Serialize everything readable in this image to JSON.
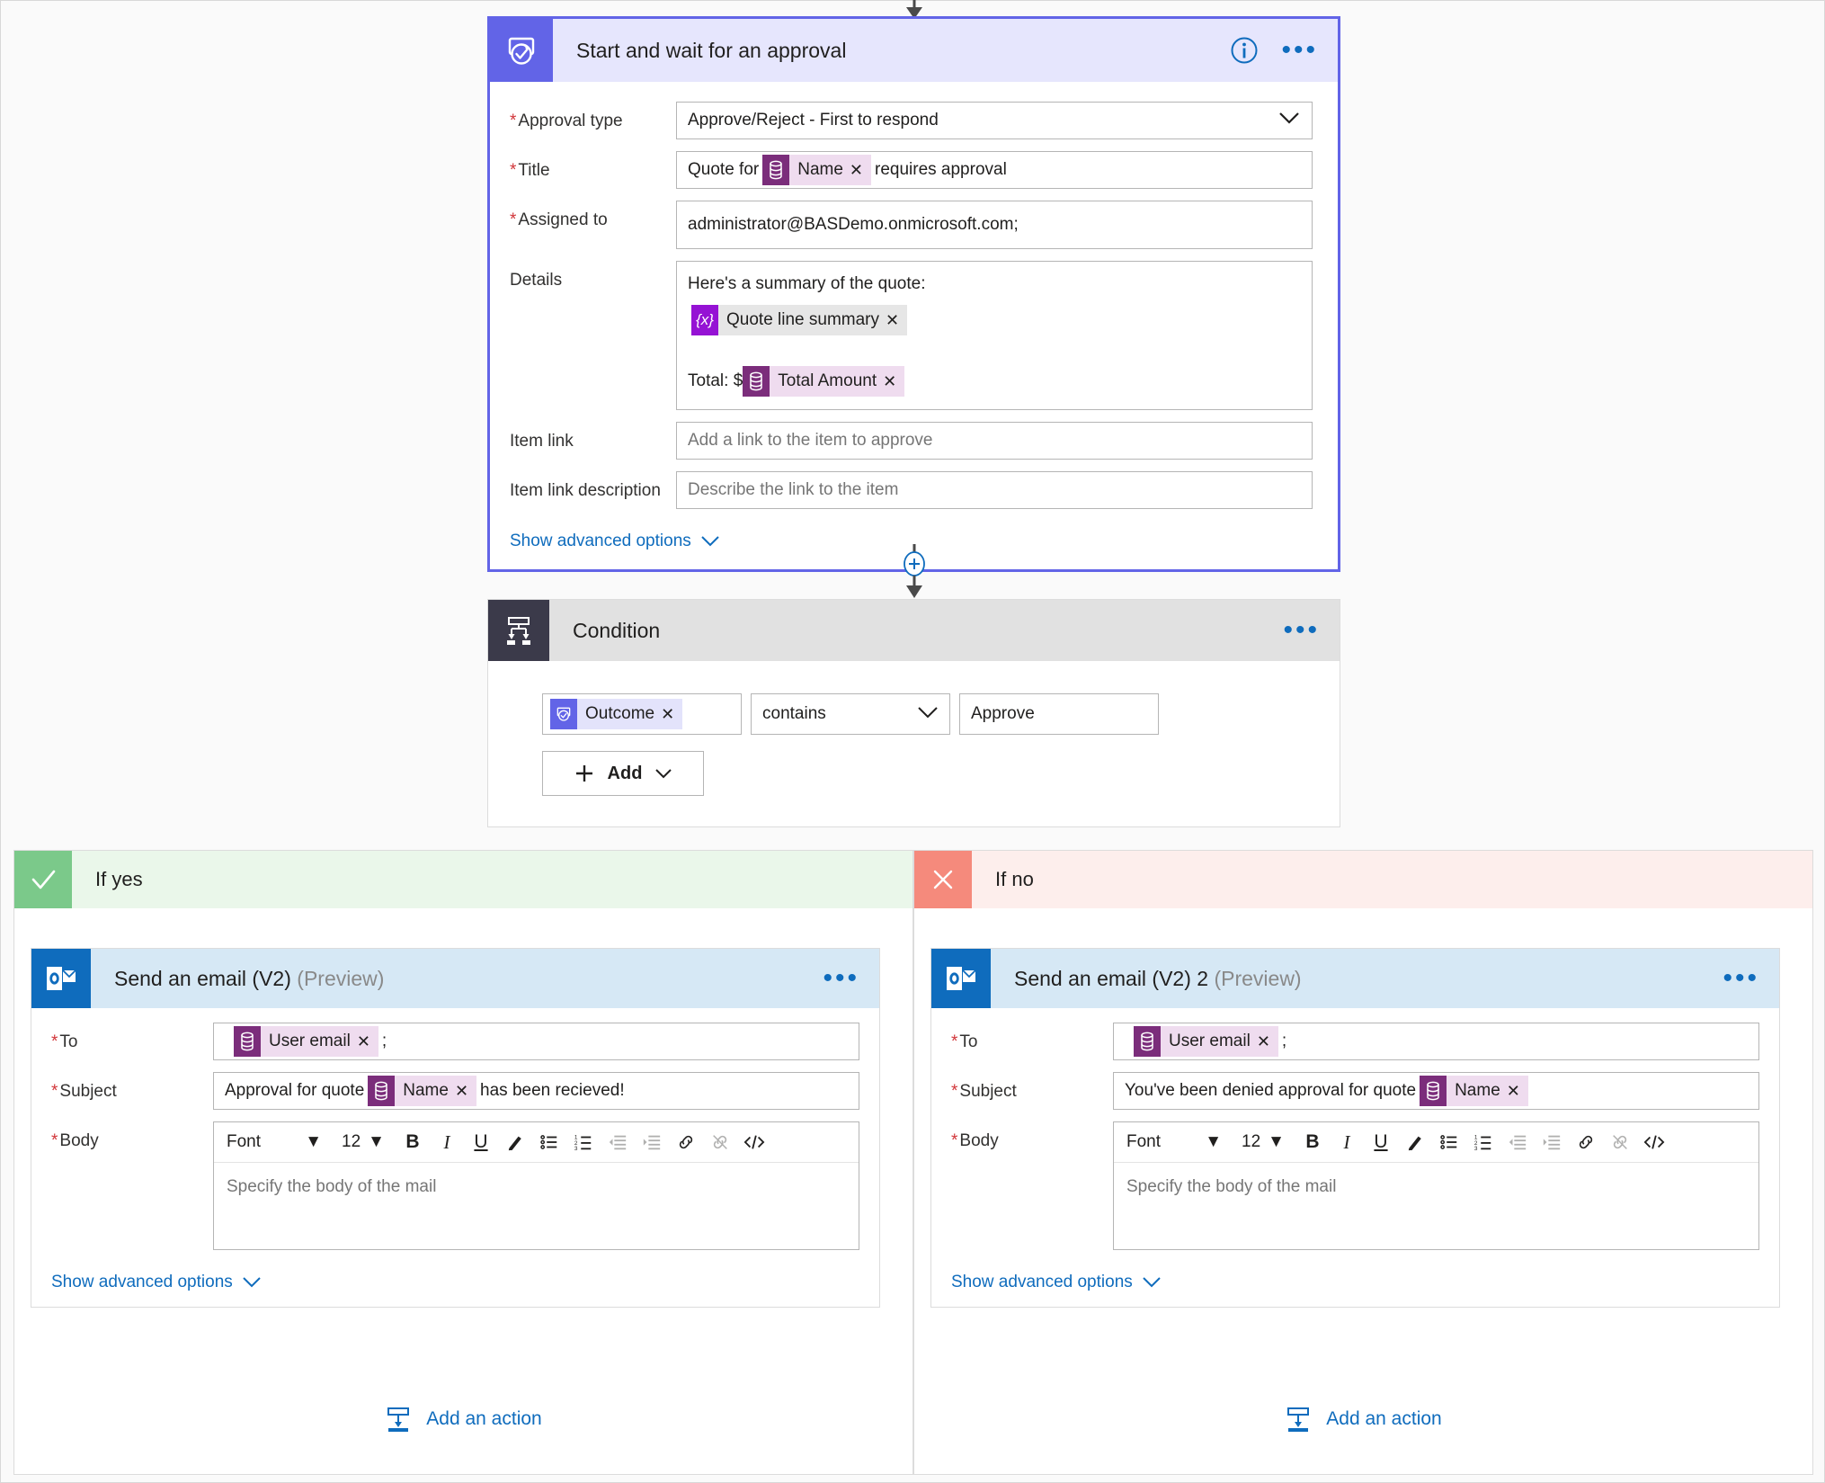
{
  "approval": {
    "title": "Start and wait for an approval",
    "icon": "approval-icon",
    "info_icon": "info-icon",
    "more_icon": "more-options-icon",
    "fields": {
      "approval_type_label": "Approval type",
      "approval_type_value": "Approve/Reject - First to respond",
      "title_label": "Title",
      "title_prefix": "Quote for",
      "title_token": "Name",
      "title_suffix": "requires approval",
      "assigned_label": "Assigned to",
      "assigned_value": "administrator@BASDemo.onmicrosoft.com;",
      "details_label": "Details",
      "details_line1": "Here's a summary of the quote:",
      "details_token1": "Quote line summary",
      "details_total_prefix": "Total: $",
      "details_token2": "Total Amount",
      "item_link_label": "Item link",
      "item_link_placeholder": "Add a link to the item to approve",
      "item_link_desc_label": "Item link description",
      "item_link_desc_placeholder": "Describe the link to the item"
    },
    "advanced_label": "Show advanced options"
  },
  "condition": {
    "title": "Condition",
    "icon": "condition-branch-icon",
    "more_icon": "more-options-icon",
    "operand_token": "Outcome",
    "operator": "contains",
    "value": "Approve",
    "add_label": "Add"
  },
  "connector": {
    "add_step_icon": "add-step-plus-icon"
  },
  "branches": [
    {
      "label": "If yes",
      "icon": "check-icon",
      "email": {
        "title": "Send an email (V2)",
        "preview": "(Preview)",
        "icon": "outlook-icon",
        "more_icon": "more-options-icon",
        "to_label": "To",
        "to_token": "User email",
        "to_suffix": ";",
        "subject_label": "Subject",
        "subject_prefix": "Approval for quote",
        "subject_token": "Name",
        "subject_suffix": "has been recieved!",
        "body_label": "Body",
        "body_placeholder": "Specify the body of the mail",
        "advanced_label": "Show advanced options"
      },
      "add_action_label": "Add an action",
      "add_action_icon": "add-action-icon"
    },
    {
      "label": "If no",
      "icon": "close-x-icon",
      "email": {
        "title": "Send an email (V2) 2",
        "preview": "(Preview)",
        "icon": "outlook-icon",
        "more_icon": "more-options-icon",
        "to_label": "To",
        "to_token": "User email",
        "to_suffix": ";",
        "subject_label": "Subject",
        "subject_prefix": "You've been denied approval for quote",
        "subject_token": "Name",
        "subject_suffix": "",
        "body_label": "Body",
        "body_placeholder": "Specify the body of the mail",
        "advanced_label": "Show advanced options"
      },
      "add_action_label": "Add an action",
      "add_action_icon": "add-action-icon"
    }
  ],
  "rich_text_toolbar": {
    "font_label": "Font",
    "size_label": "12",
    "bold": "B",
    "italic": "I",
    "underline": "U",
    "font_color_icon": "font-color-icon",
    "bulleted_list_icon": "bulleted-list-icon",
    "numbered_list_icon": "numbered-list-icon",
    "indent_icon": "indent-icon",
    "outdent_icon": "outdent-icon",
    "link_icon": "link-icon",
    "unlink_icon": "unlink-icon",
    "code_view_icon": "code-view-icon"
  },
  "colors": {
    "approval_accent": "#6264e7",
    "condition_accent": "#3b3a4a",
    "outlook_accent": "#0f6cbd",
    "yes_accent": "#7bc98a",
    "no_accent": "#f58a7c",
    "link": "#0f6cbd",
    "required": "#d13438",
    "entity_token": "#7b2d7b",
    "variable_token": "#9512d4"
  }
}
